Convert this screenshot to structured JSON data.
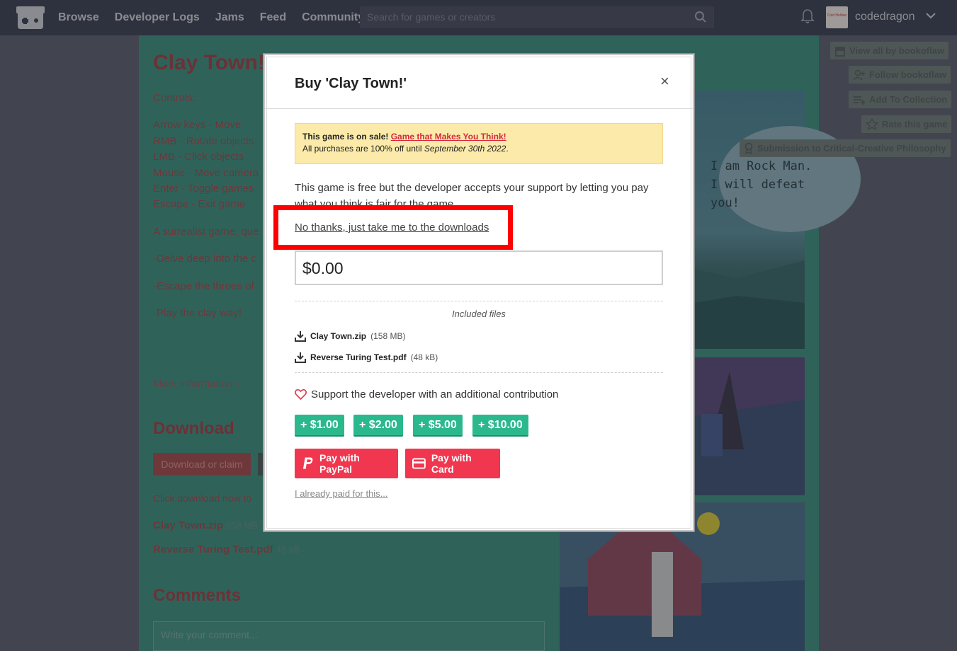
{
  "header": {
    "nav": [
      "Browse",
      "Developer Logs",
      "Jams",
      "Feed",
      "Community"
    ],
    "search_placeholder": "Search for games or creators",
    "username": "codedragon",
    "avatar_text": "Cold Heldan"
  },
  "page": {
    "game_title": "Clay Town!",
    "controls_heading": "Controls:",
    "controls": [
      "Arrow keys - Move",
      "RMB - Rotate objects",
      "LMB - Click objects",
      "Mouse - Move camera",
      "Enter - Toggle games",
      "Escape - Exit game"
    ],
    "blurb": "A surrealist game, que",
    "bullets": [
      "-Delve deep into the c",
      "-Escape the throes of",
      "-Play the clay way!"
    ],
    "more_info": "More information ›",
    "download_heading": "Download",
    "download_button": "Download or claim",
    "click_download": "Click download now to",
    "files": [
      {
        "name": "Clay Town.zip",
        "size": "158 MB"
      },
      {
        "name": "Reverse Turing Test.pdf",
        "size": "48 kB"
      }
    ],
    "comments_heading": "Comments",
    "comment_placeholder": "Write your comment...",
    "screenshot_text": [
      "I am Rock Man.",
      "I will defeat",
      "you!"
    ]
  },
  "sidebar": {
    "view_all": "View all by bookoflaw",
    "follow": "Follow bookoflaw",
    "add_collection": "Add To Collection",
    "rate": "Rate this game",
    "submission": "Submission to Critical-Creative Philosophy"
  },
  "modal": {
    "title": "Buy 'Clay Town!'",
    "close": "×",
    "sale_lead": "This game is on sale!",
    "sale_link": "Game that Makes You Think!",
    "sale_text_pre": "All purchases are 100% off until ",
    "sale_date": "September 30th 2022",
    "sale_text_post": ".",
    "free_text": "This game is free but the developer accepts your support by letting you pay what you think is fair for the game.",
    "no_thanks": "No thanks, just take me to the downloads",
    "price_value": "$0.00",
    "included_files": "Included files",
    "files": [
      {
        "name": "Clay Town.zip",
        "size": "(158 MB)"
      },
      {
        "name": "Reverse Turing Test.pdf",
        "size": "(48 kB)"
      }
    ],
    "support_text": "Support the developer with an additional contribution",
    "tips": [
      "+ $1.00",
      "+ $2.00",
      "+ $5.00",
      "+ $10.00"
    ],
    "paypal": "Pay with PayPal",
    "card": "Pay with Card",
    "already_paid": "I already paid for this..."
  },
  "colors": {
    "header_bg": "#3d4150",
    "page_bg": "#3e8c7b",
    "accent_red": "#f0374f",
    "tip_green": "#2bb88d",
    "highlight": "#ff0000"
  }
}
